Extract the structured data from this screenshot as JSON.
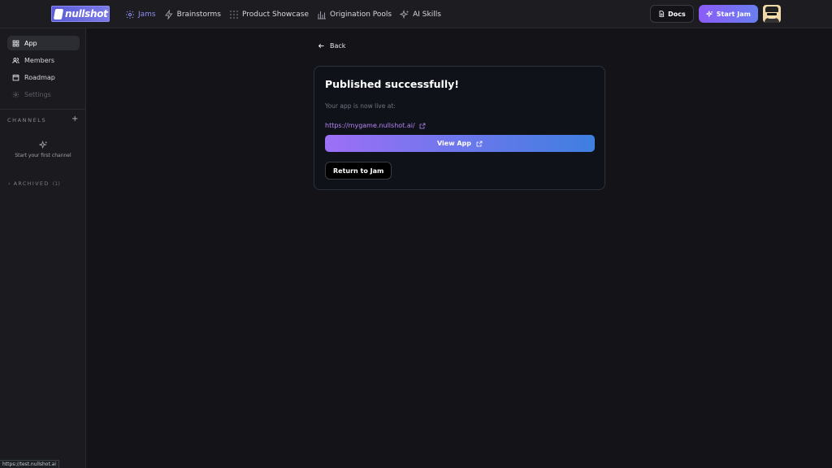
{
  "header": {
    "logo_text": "nullshot",
    "nav": [
      {
        "label": "Jams",
        "icon": "gear-icon",
        "active": true
      },
      {
        "label": "Brainstorms",
        "icon": "lightning-icon",
        "active": false
      },
      {
        "label": "Product Showcase",
        "icon": "grid-dots-icon",
        "active": false
      },
      {
        "label": "Origination Pools",
        "icon": "bar-chart-icon",
        "active": false
      },
      {
        "label": "AI Skills",
        "icon": "sparkles-icon",
        "active": false
      }
    ],
    "docs_label": "Docs",
    "start_jam_label": "Start Jam"
  },
  "sidebar": {
    "items": [
      {
        "label": "App",
        "icon": "grid-icon",
        "active": true
      },
      {
        "label": "Members",
        "icon": "users-icon",
        "active": false
      },
      {
        "label": "Roadmap",
        "icon": "calendar-icon",
        "active": false
      },
      {
        "label": "Settings",
        "icon": "gear-icon",
        "disabled": true
      }
    ],
    "channels_label": "CHANNELS",
    "add_channel_label": "+",
    "empty_channels_text": "Start your first channel",
    "archived_label": "ARCHIVED",
    "archived_count": "(1)"
  },
  "main": {
    "back_label": "Back",
    "card": {
      "title": "Published successfully!",
      "subtitle": "Your app is now live at:",
      "url": "https://mygame.nullshot.ai/",
      "view_app_label": "View App",
      "return_label": "Return to Jam"
    }
  },
  "status_url": "https://test.nullshot.ai",
  "colors": {
    "accent": "#8e8ef2",
    "link": "#b683f5",
    "gradient_start": "#9d6ff7",
    "gradient_end": "#3e7fe0"
  }
}
